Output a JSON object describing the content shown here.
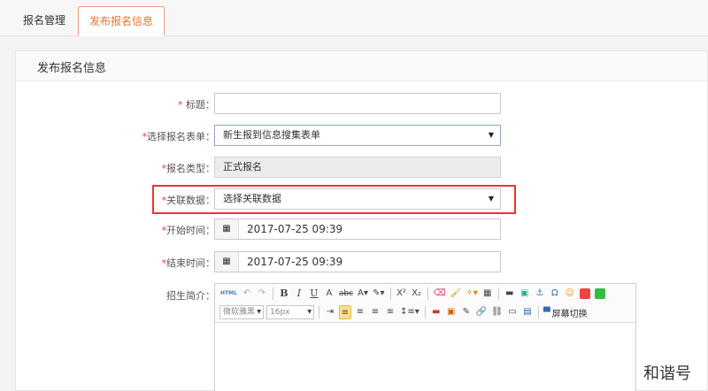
{
  "tabs": [
    {
      "label": "报名管理",
      "active": false
    },
    {
      "label": "发布报名信息",
      "active": true
    }
  ],
  "panel": {
    "title": "发布报名信息"
  },
  "form": {
    "title": {
      "required_mark": "* ",
      "label": "标题：",
      "value": ""
    },
    "form_select": {
      "required_mark": "*",
      "label": "选择报名表单：",
      "value": "新生报到信息搜集表单"
    },
    "type": {
      "required_mark": "*",
      "label": "报名类型：",
      "value": "正式报名"
    },
    "related": {
      "required_mark": "*",
      "label": "关联数据：",
      "value": "选择关联数据"
    },
    "start": {
      "required_mark": "*",
      "label": "开始时间：",
      "value": "2017-07-25 09:39"
    },
    "end": {
      "required_mark": "*",
      "label": "结束时间：",
      "value": "2017-07-25 09:39"
    },
    "intro": {
      "label": "招生简介："
    }
  },
  "editor": {
    "font_family": "微软雅黑",
    "font_size": "16px",
    "fullscreen_label": "屏幕切换",
    "toolbar_row1": [
      {
        "name": "source-html-icon",
        "glyph": "HTML"
      },
      {
        "name": "undo-icon",
        "glyph": "↶"
      },
      {
        "name": "redo-icon",
        "glyph": "↷"
      },
      {
        "name": "bold-icon",
        "glyph": "B"
      },
      {
        "name": "italic-icon",
        "glyph": "I"
      },
      {
        "name": "underline-icon",
        "glyph": "U"
      },
      {
        "name": "border-a-icon",
        "glyph": "A"
      },
      {
        "name": "strikethrough-icon",
        "glyph": "abc"
      },
      {
        "name": "font-color-icon",
        "glyph": "A▾"
      },
      {
        "name": "highlight-color-icon",
        "glyph": "✎▾"
      },
      {
        "name": "superscript-icon",
        "glyph": "X²"
      },
      {
        "name": "subscript-icon",
        "glyph": "X₂"
      },
      {
        "name": "eraser-icon",
        "glyph": "⌫"
      },
      {
        "name": "format-brush-icon",
        "glyph": "🖌"
      },
      {
        "name": "auto-format-icon",
        "glyph": "✧▾"
      },
      {
        "name": "table-icon",
        "glyph": "▦"
      },
      {
        "name": "horizontal-rule-icon",
        "glyph": "▬"
      },
      {
        "name": "image-icon",
        "glyph": "▣"
      },
      {
        "name": "anchor-icon",
        "glyph": "⚓"
      },
      {
        "name": "special-char-icon",
        "glyph": "Ω"
      },
      {
        "name": "emoticon-icon",
        "glyph": "☺"
      },
      {
        "name": "attachment-icon",
        "glyph": "■"
      },
      {
        "name": "map-icon",
        "glyph": "■"
      }
    ],
    "toolbar_row2": [
      {
        "name": "indent-icon",
        "glyph": "⇥"
      },
      {
        "name": "align-left-icon",
        "glyph": "≡"
      },
      {
        "name": "align-center-icon",
        "glyph": "≡"
      },
      {
        "name": "align-right-icon",
        "glyph": "≡"
      },
      {
        "name": "align-justify-icon",
        "glyph": "≡"
      },
      {
        "name": "line-height-icon",
        "glyph": "↕≡▾"
      },
      {
        "name": "insert-image-icon",
        "glyph": "▬"
      },
      {
        "name": "insert-media-icon",
        "glyph": "▣"
      },
      {
        "name": "insert-flash-icon",
        "glyph": "✎"
      },
      {
        "name": "link-icon",
        "glyph": "🔗"
      },
      {
        "name": "unlink-icon",
        "glyph": "⛓"
      },
      {
        "name": "page-break-icon",
        "glyph": "▭"
      },
      {
        "name": "save-icon",
        "glyph": "▤"
      }
    ]
  },
  "colors": {
    "accent": "#e8742c",
    "required": "#e03b3b",
    "highlight_box": "#ee3333"
  },
  "watermark": "和谐号"
}
